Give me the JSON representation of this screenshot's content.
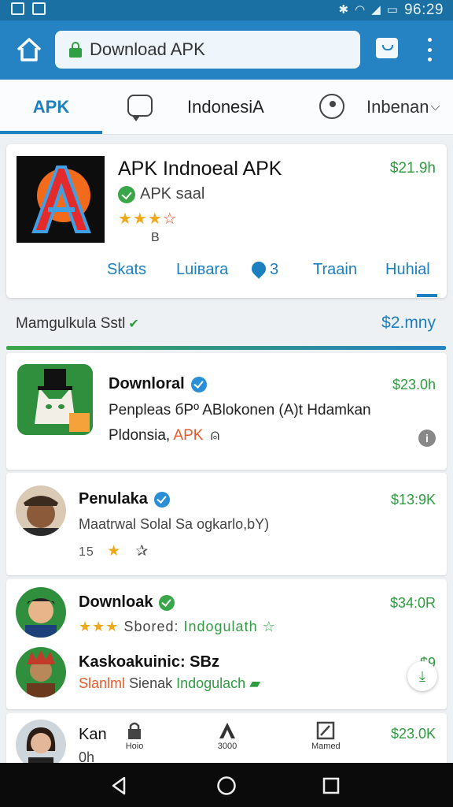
{
  "status_bar": {
    "time": "96:29"
  },
  "browser": {
    "url": "Download APK",
    "icons": {
      "home": "home-icon",
      "lock": "lock-icon",
      "tabs": "tabs-icon",
      "menu": "overflow-menu-icon"
    }
  },
  "tabs": {
    "apk": "APK",
    "indonesia": "IndonesiA",
    "language": "Inbenan",
    "icons": {
      "chat": "chat-icon",
      "globe": "globe-icon",
      "chevron": "chevron-down-icon"
    }
  },
  "featured": {
    "title": "APK Indnoeаl APK",
    "price": "$21.9h",
    "subtitle": "APK saal",
    "rating": 3.5,
    "rating_count": "B",
    "actions": [
      "Skats",
      "Luiвara",
      "3",
      "Traain",
      "Huhial"
    ]
  },
  "section": {
    "title": "Mamgulkula Sstl",
    "link": "$2.mny"
  },
  "list": [
    {
      "title": "Downloral",
      "price": "$23.0h",
      "line1": "Penpleas бPº ABlokonen (A)t Hdamkan",
      "line2_prefix": "Pldonsia,",
      "line2_highlight": "APK",
      "verified": "blue"
    },
    {
      "title": "Penulaka",
      "price": "$13:9K",
      "line1": "Mаatrwal Solal Sa ogkarlo,bY)",
      "rating_count": "15"
    },
    {
      "title": "Downloak",
      "price": "$34:0R",
      "line_prefix": "Sbored:",
      "line_highlight": "Indogulath"
    },
    {
      "title": "Kaskoakuinic: SBz",
      "price": "$9",
      "line_prefix": "Slanlml",
      "line_mid": "Sienak",
      "line_highlight": "Indogulach"
    },
    {
      "title": "Kan",
      "price": "$23.0K",
      "subtitle": "0h"
    }
  ],
  "bottom_overlay": [
    "Hoio",
    "3000",
    "Mamed"
  ],
  "colors": {
    "primary": "#2583c4",
    "accent_green": "#2e9c3f",
    "star": "#f0a81a"
  }
}
